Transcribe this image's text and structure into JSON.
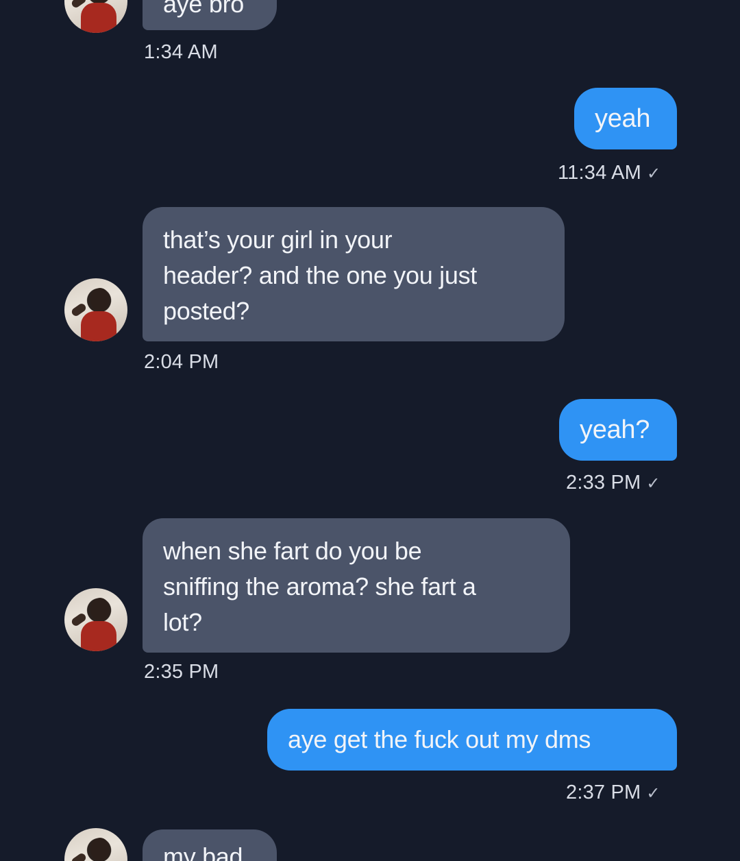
{
  "messages": [
    {
      "direction": "incoming",
      "text": "aye bro",
      "time": "1:34 AM"
    },
    {
      "direction": "outgoing",
      "text": "yeah",
      "time": "11:34 AM",
      "status": "✓"
    },
    {
      "direction": "incoming",
      "lines": [
        "that’s your girl in your",
        "header? and the one you just",
        "posted?"
      ],
      "time": "2:04 PM"
    },
    {
      "direction": "outgoing",
      "text": "yeah?",
      "time": "2:33 PM",
      "status": "✓"
    },
    {
      "direction": "incoming",
      "lines": [
        "when she fart do you be",
        "sniffing the aroma? she fart a",
        "lot?"
      ],
      "time": "2:35 PM"
    },
    {
      "direction": "outgoing",
      "text": "aye get the fuck out my dms",
      "time": "2:37 PM",
      "status": "✓"
    },
    {
      "direction": "incoming",
      "text": "my bad"
    }
  ],
  "colors": {
    "background": "#151b2a",
    "incoming_bubble": "#4b5469",
    "outgoing_bubble": "#2f93f4",
    "text": "#f2f4f8"
  }
}
